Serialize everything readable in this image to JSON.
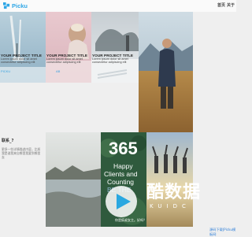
{
  "header": {
    "logo_text": "Picku",
    "nav": [
      "首页",
      "关于"
    ]
  },
  "cards": [
    {
      "title": "YOUR PROJECT TITLE",
      "desc_line1": "Lorem ipsum dolor sit amet",
      "desc_line2": "consectetur adipiscing elit",
      "meta": "PICKU"
    },
    {
      "title": "YOUR PROJECT TITLE",
      "desc_line1": "Lorem ipsum dolor sit amet",
      "desc_line2": "consectetur adipiscing elit",
      "meta": "AB"
    },
    {
      "title": "YOUR PROJECT TITLE",
      "desc_line1": "Lorem ipsum dolor sit amet",
      "desc_line2": "consectetur adipiscing elit",
      "meta": ""
    }
  ],
  "side_card": {
    "title": "联系_?",
    "desc": "更多一些详情描述内容，比如我是谁我来自哪里我要到哪里去"
  },
  "promo": {
    "number": "365",
    "line1": "Happy",
    "line2": "Clients and",
    "line3": "Counting",
    "line4": "BE THE",
    "caption": "你是疯叔女主。好吗？"
  },
  "watermark": {
    "title": "酷数据",
    "sub": "KUIDC"
  },
  "footer": {
    "link": "源码下载|Picku模板网"
  }
}
